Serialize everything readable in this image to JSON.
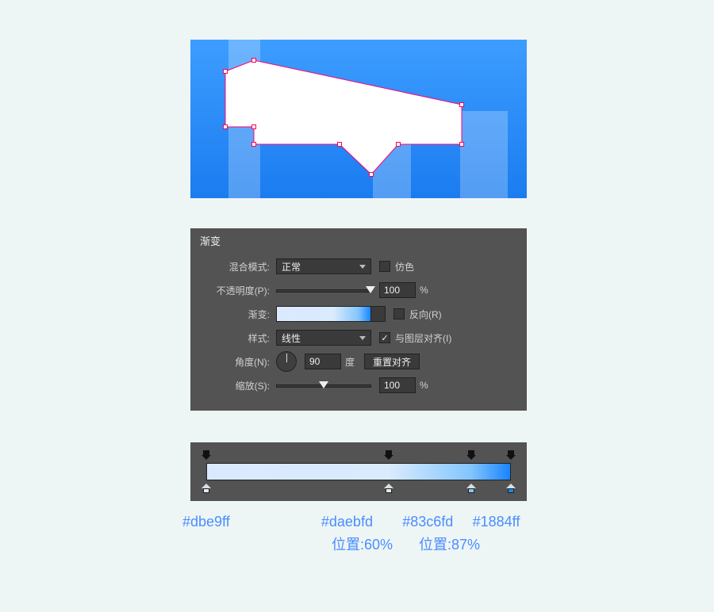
{
  "panel": {
    "title": "渐变",
    "blendMode": {
      "label": "混合模式:",
      "value": "正常"
    },
    "dither": {
      "label": "仿色"
    },
    "opacity": {
      "label": "不透明度(P):",
      "value": "100",
      "unit": "%",
      "sliderPercent": 100
    },
    "gradient": {
      "label": "渐变:"
    },
    "reverse": {
      "label": "反向(R)"
    },
    "style": {
      "label": "样式:",
      "value": "线性"
    },
    "alignLayer": {
      "label": "与图层对齐(I)",
      "checked": true
    },
    "angle": {
      "label": "角度(N):",
      "value": "90",
      "unit": "度"
    },
    "resetAlign": "重置对齐",
    "scale": {
      "label": "缩放(S):",
      "value": "100",
      "unit": "%",
      "sliderPercent": 50
    }
  },
  "gradientStops": {
    "topOpacity": [
      0,
      60,
      87,
      100
    ],
    "bottomColors": [
      {
        "pos": 0,
        "color": "#dbe9ff"
      },
      {
        "pos": 60,
        "color": "#daebfd"
      },
      {
        "pos": 87,
        "color": "#83c6fd"
      },
      {
        "pos": 100,
        "color": "#1884ff"
      }
    ]
  },
  "legend": {
    "c1": "#dbe9ff",
    "c2": "#daebfd",
    "c3": "#83c6fd",
    "c4": "#1884ff",
    "p2": "位置:60%",
    "p3": "位置:87%"
  }
}
